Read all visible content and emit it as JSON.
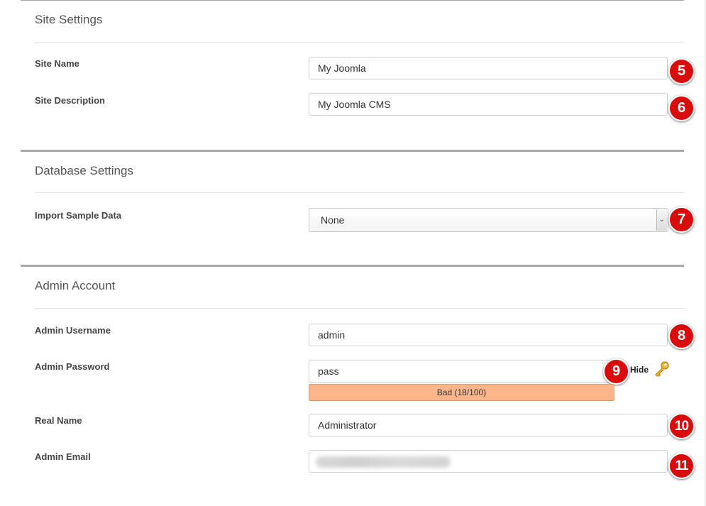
{
  "site_settings": {
    "title": "Site Settings",
    "site_name": {
      "label": "Site Name",
      "value": "My Joomla",
      "marker": "5"
    },
    "site_description": {
      "label": "Site Description",
      "value": "My Joomla CMS",
      "marker": "6"
    }
  },
  "database_settings": {
    "title": "Database Settings",
    "import_sample": {
      "label": "Import Sample Data",
      "value": "None",
      "marker": "7"
    }
  },
  "admin_account": {
    "title": "Admin Account",
    "username": {
      "label": "Admin Username",
      "value": "admin",
      "marker": "8"
    },
    "password": {
      "label": "Admin Password",
      "value": "pass",
      "marker": "9",
      "toggle": "Hide",
      "strength_text": "Bad (18/100)",
      "strength_score": 18
    },
    "real_name": {
      "label": "Real Name",
      "value": "Administrator",
      "marker": "10"
    },
    "email": {
      "label": "Admin Email",
      "value": "",
      "marker": "11"
    }
  },
  "colors": {
    "marker": "#d90c0c",
    "strength_bad": "#fdb68c",
    "rule": "#a8a8a8"
  },
  "icons": {
    "toggle": "key-icon",
    "select_arrow": "chevron-down-icon"
  }
}
